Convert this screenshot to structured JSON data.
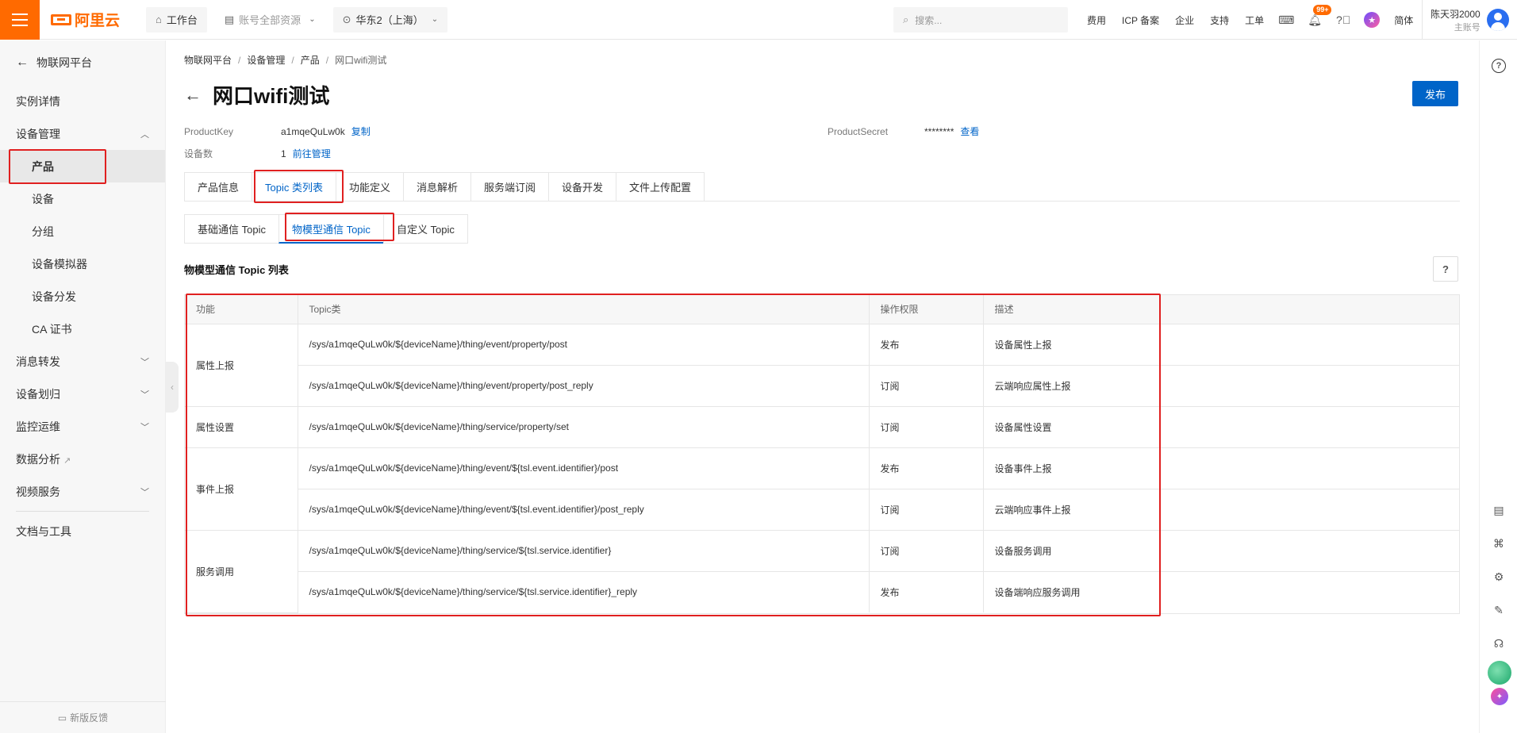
{
  "topbar": {
    "logo": "阿里云",
    "workbench": "工作台",
    "resources": "账号全部资源",
    "region": "华东2（上海）",
    "search_placeholder": "搜索...",
    "links": [
      "费用",
      "ICP 备案",
      "企业",
      "支持",
      "工单"
    ],
    "badge": "99+",
    "lang": "简体",
    "user_name": "陈天羽2000",
    "user_role": "主账号"
  },
  "sidebar": {
    "back": "物联网平台",
    "items": [
      {
        "label": "实例详情"
      },
      {
        "label": "设备管理"
      },
      {
        "label": "产品"
      },
      {
        "label": "设备"
      },
      {
        "label": "分组"
      },
      {
        "label": "设备模拟器"
      },
      {
        "label": "设备分发"
      },
      {
        "label": "CA 证书"
      },
      {
        "label": "消息转发"
      },
      {
        "label": "设备划归"
      },
      {
        "label": "监控运维"
      },
      {
        "label": "数据分析"
      },
      {
        "label": "视频服务"
      },
      {
        "label": "文档与工具"
      }
    ],
    "feedback": "新版反馈"
  },
  "breadcrumb": [
    "物联网平台",
    "设备管理",
    "产品",
    "网口wifi测试"
  ],
  "page": {
    "title": "网口wifi测试",
    "publish": "发布",
    "product_key_label": "ProductKey",
    "product_key": "a1mqeQuLw0k",
    "copy": "复制",
    "device_count_label": "设备数",
    "device_count": "1",
    "manage": "前往管理",
    "secret_label": "ProductSecret",
    "secret": "********",
    "view": "查看"
  },
  "tabs": [
    "产品信息",
    "Topic 类列表",
    "功能定义",
    "消息解析",
    "服务端订阅",
    "设备开发",
    "文件上传配置"
  ],
  "subtabs": [
    "基础通信 Topic",
    "物模型通信 Topic",
    "自定义 Topic"
  ],
  "section_title": "物模型通信 Topic 列表",
  "help": "?",
  "table": {
    "headers": [
      "功能",
      "Topic类",
      "操作权限",
      "描述"
    ],
    "groups": [
      {
        "func": "属性上报",
        "rows": [
          {
            "topic": "/sys/a1mqeQuLw0k/${deviceName}/thing/event/property/post",
            "perm": "发布",
            "desc": "设备属性上报"
          },
          {
            "topic": "/sys/a1mqeQuLw0k/${deviceName}/thing/event/property/post_reply",
            "perm": "订阅",
            "desc": "云端响应属性上报"
          }
        ]
      },
      {
        "func": "属性设置",
        "rows": [
          {
            "topic": "/sys/a1mqeQuLw0k/${deviceName}/thing/service/property/set",
            "perm": "订阅",
            "desc": "设备属性设置"
          }
        ]
      },
      {
        "func": "事件上报",
        "rows": [
          {
            "topic": "/sys/a1mqeQuLw0k/${deviceName}/thing/event/${tsl.event.identifier}/post",
            "perm": "发布",
            "desc": "设备事件上报"
          },
          {
            "topic": "/sys/a1mqeQuLw0k/${deviceName}/thing/event/${tsl.event.identifier}/post_reply",
            "perm": "订阅",
            "desc": "云端响应事件上报"
          }
        ]
      },
      {
        "func": "服务调用",
        "rows": [
          {
            "topic": "/sys/a1mqeQuLw0k/${deviceName}/thing/service/${tsl.service.identifier}",
            "perm": "订阅",
            "desc": "设备服务调用"
          },
          {
            "topic": "/sys/a1mqeQuLw0k/${deviceName}/thing/service/${tsl.service.identifier}_reply",
            "perm": "发布",
            "desc": "设备端响应服务调用"
          }
        ]
      }
    ]
  }
}
